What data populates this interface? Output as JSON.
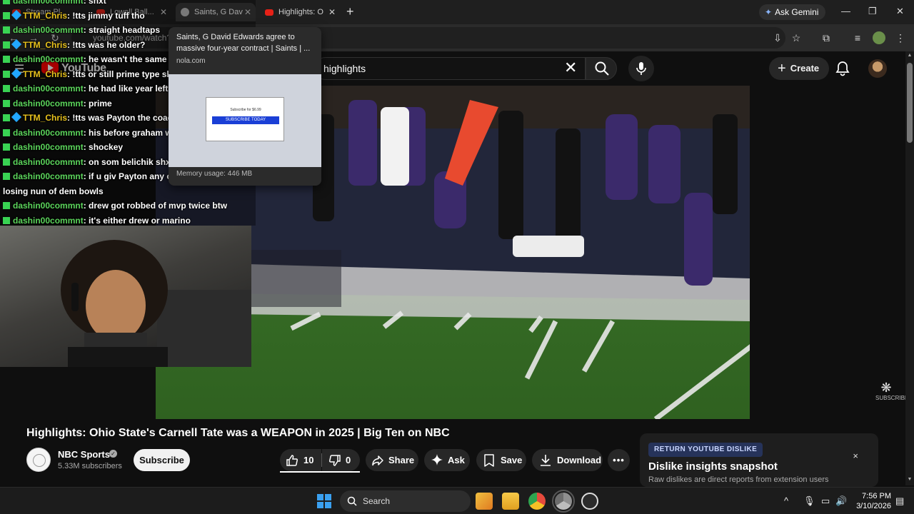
{
  "browser": {
    "tabs": [
      {
        "title": "Stream Pl...",
        "active": false
      },
      {
        "title": "Lowell Ball...",
        "active": false
      },
      {
        "title": "Saints, G Dav",
        "active": true
      },
      {
        "title": "Highlights: O",
        "active": false
      }
    ],
    "ask_gemini": "Ask Gemini",
    "url": "youtube.com/watch?"
  },
  "hover_card": {
    "title": "Saints, G David Edwards agree to massive four-year contract | Saints | ...",
    "domain": "nola.com",
    "thumb_sub": "Subscribe for $6.99",
    "thumb_cta": "SUBSCRIBE TODAY",
    "memory": "Memory usage: 446 MB"
  },
  "youtube": {
    "logo_text": "YouTube",
    "search_query": "highlights",
    "create_label": "Create",
    "video_title": "Highlights: Ohio State's Carnell Tate was a WEAPON in 2025 | Big Ten on NBC",
    "channel": {
      "name": "NBC Sports",
      "subscribers": "5.33M subscribers"
    },
    "subscribe_label": "Subscribe",
    "actions": {
      "likes": "10",
      "dislikes": "0",
      "share": "Share",
      "ask": "Ask",
      "save": "Save",
      "download": "Download",
      "more": "•••"
    },
    "watermark": "SUBSCRIBE"
  },
  "rytd": {
    "tag": "RETURN YOUTUBE DISLIKE",
    "title": "Dislike insights snapshot",
    "subtitle": "Raw dislikes are direct reports from extension users",
    "close": "×"
  },
  "chat": [
    {
      "user": "dashin00commnt",
      "msg": ": shxt",
      "color": "green",
      "badge2": false
    },
    {
      "user": "TTM_Chris",
      "msg": ": !tts jimmy tuff tho",
      "color": "yellow",
      "badge2": true
    },
    {
      "user": "dashin00commnt",
      "msg": ": straight headtaps",
      "color": "green",
      "badge2": false
    },
    {
      "user": "TTM_Chris",
      "msg": ": !tts was he older?",
      "color": "yellow",
      "badge2": true
    },
    {
      "user": "dashin00commnt",
      "msg": ": he wasn't the same",
      "color": "green",
      "badge2": false
    },
    {
      "user": "TTM_Chris",
      "msg": ": !tts or still prime type shit?",
      "color": "yellow",
      "badge2": true
    },
    {
      "user": "dashin00commnt",
      "msg": ": he had like year left of orime",
      "color": "green",
      "badge2": false
    },
    {
      "user": "dashin00commnt",
      "msg": ": prime",
      "color": "green",
      "badge2": false
    },
    {
      "user": "TTM_Chris",
      "msg": ": !tts was Payton the coach with that bill guy?",
      "color": "yellow",
      "badge2": true
    },
    {
      "user": "dashin00commnt",
      "msg": ": his before graham we had Shockey",
      "color": "green",
      "badge2": false
    },
    {
      "user": "dashin00commnt",
      "msg": ": shockey",
      "color": "green",
      "badge2": false
    },
    {
      "user": "dashin00commnt",
      "msg": ": on som belichik shxt",
      "color": "green",
      "badge2": false
    },
    {
      "user": "dashin00commnt",
      "msg": ": if u giv Payton any one of those patriots teams he not",
      "color": "green",
      "badge2": false
    },
    {
      "user": "",
      "msg": "losing nun of dem bowls",
      "color": "green",
      "badge2": false
    },
    {
      "user": "dashin00commnt",
      "msg": ": drew got robbed of mvp twice btw",
      "color": "green",
      "badge2": false
    },
    {
      "user": "dashin00commnt",
      "msg": ": it's either drew or marino",
      "color": "green",
      "badge2": false
    }
  ],
  "taskbar": {
    "search_label": "Search",
    "time": "7:56 PM",
    "date": "3/10/2026"
  },
  "icons": [
    "search-icon",
    "mic-icon",
    "bell-icon",
    "plus-icon",
    "close-icon",
    "thumbs-up-icon",
    "thumbs-down-icon",
    "share-icon",
    "sparkle-icon",
    "bookmark-icon",
    "download-icon",
    "windows-start-icon",
    "chrome-icon",
    "file-explorer-icon"
  ]
}
